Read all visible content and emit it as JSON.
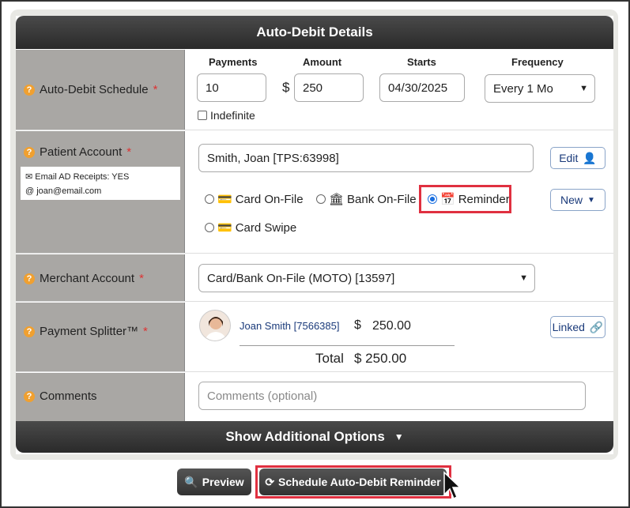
{
  "header": {
    "title": "Auto-Debit Details"
  },
  "schedule": {
    "label": "Auto-Debit Schedule",
    "col_payments": "Payments",
    "col_amount": "Amount",
    "col_starts": "Starts",
    "col_frequency": "Frequency",
    "payments_value": "10",
    "currency": "$",
    "amount_value": "250",
    "starts_value": "04/30/2025",
    "frequency_value": "Every 1 Mo",
    "indefinite_label": "Indefinite"
  },
  "patient": {
    "label": "Patient Account",
    "receipts": "Email AD Receipts: YES",
    "email": "joan@email.com",
    "account_value": "Smith, Joan [TPS:63998]",
    "edit_label": "Edit",
    "new_label": "New",
    "opt_card_on_file": "Card On-File",
    "opt_bank_on_file": "Bank On-File",
    "opt_reminder": "Reminder",
    "opt_card_swipe": "Card Swipe"
  },
  "merchant": {
    "label": "Merchant Account",
    "value": "Card/Bank On-File (MOTO) [13597]"
  },
  "splitter": {
    "label": "Payment Splitter™",
    "name": "Joan Smith [7566385]",
    "currency": "$",
    "amount": "250.00",
    "linked_label": "Linked",
    "total_label": "Total",
    "total_value": "$ 250.00"
  },
  "comments": {
    "label": "Comments",
    "placeholder": "Comments (optional)"
  },
  "footer": {
    "more_options": "Show Additional Options",
    "preview": "Preview",
    "schedule": "Schedule Auto-Debit Reminder"
  },
  "colors": {
    "accent": "#1a3a7a",
    "highlight": "#e03040",
    "label_bg": "#a9a7a4"
  }
}
